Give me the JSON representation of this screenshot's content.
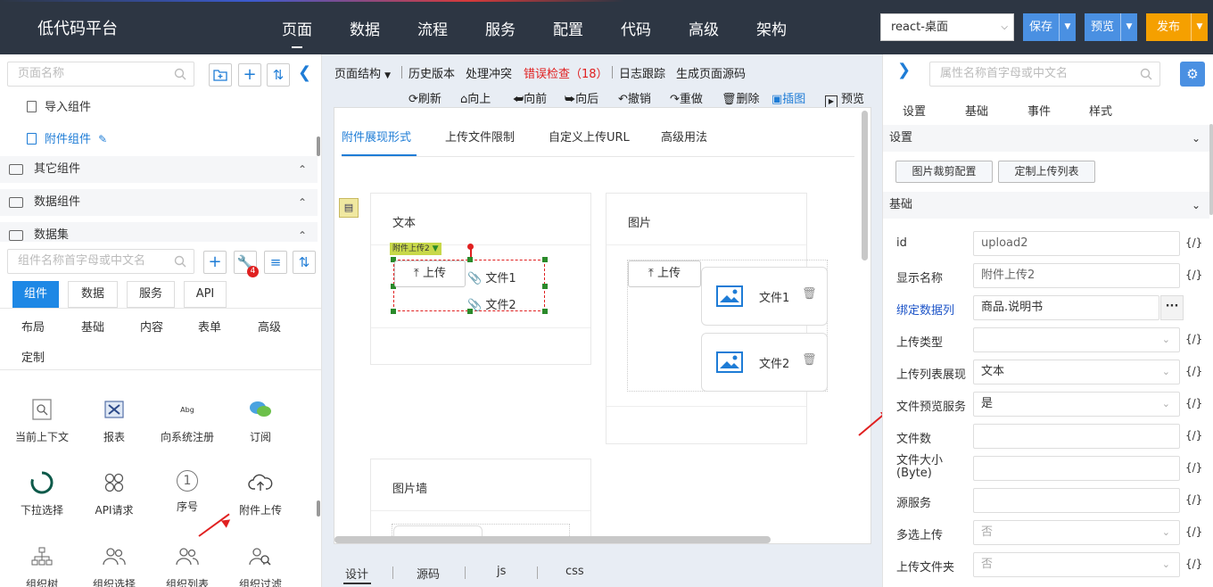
{
  "topbar": {
    "logo": "低代码平台",
    "nav": [
      "页面",
      "数据",
      "流程",
      "服务",
      "配置",
      "代码",
      "高级",
      "架构"
    ],
    "active_nav": "页面",
    "platform_select": "react-桌面",
    "save_label": "保存",
    "preview_label": "预览",
    "publish_label": "发布",
    "colors": {
      "bar": "#2d3643",
      "save": "#4a90e2",
      "publish": "#f5a000"
    }
  },
  "left": {
    "page_search_placeholder": "页面名称",
    "tree": [
      {
        "label": "导入组件"
      },
      {
        "label": "附件组件",
        "selected": true
      }
    ],
    "groups": [
      "其它组件",
      "数据组件",
      "数据集"
    ],
    "comp_search_placeholder": "组件名称首字母或中文名",
    "badge_count": "4",
    "tabs": [
      "组件",
      "数据",
      "服务",
      "API"
    ],
    "active_tab": "组件",
    "categories": [
      "布局",
      "基础",
      "内容",
      "表单",
      "高级",
      "定制"
    ],
    "components": [
      {
        "label": "当前上下文",
        "icon": "context-icon"
      },
      {
        "label": "报表",
        "icon": "report-icon"
      },
      {
        "label": "向系统注册",
        "icon": "abg-icon",
        "icon_text": "Abg"
      },
      {
        "label": "订阅",
        "icon": "chat-icon"
      },
      {
        "label": "下拉选择",
        "icon": "spinner-icon"
      },
      {
        "label": "API请求",
        "icon": "api-icon"
      },
      {
        "label": "序号",
        "icon": "number-icon",
        "icon_text": "1"
      },
      {
        "label": "附件上传",
        "icon": "cloud-upload-icon"
      },
      {
        "label": "组织树",
        "icon": "org-tree-icon"
      },
      {
        "label": "组织选择",
        "icon": "org-select-icon"
      },
      {
        "label": "组织列表",
        "icon": "org-list-icon"
      },
      {
        "label": "组织过滤",
        "icon": "org-filter-icon"
      }
    ]
  },
  "center": {
    "toolbar1": [
      "页面结构",
      "历史版本",
      "处理冲突",
      "错误检查（18）",
      "日志跟踪",
      "生成页面源码"
    ],
    "toolbar2": [
      "刷新",
      "向上",
      "向前",
      "向后",
      "撤销",
      "重做",
      "删除",
      "插图",
      "预览"
    ],
    "canvas_tabs": [
      "附件展现形式",
      "上传文件限制",
      "自定义上传URL",
      "高级用法"
    ],
    "active_canvas_tab": "附件展现形式",
    "card_text": {
      "title": "文本",
      "tag": "附件上传2",
      "upload": "上传",
      "files": [
        "文件1",
        "文件2"
      ]
    },
    "card_image": {
      "title": "图片",
      "upload": "上传",
      "files": [
        "文件1",
        "文件2"
      ]
    },
    "card_wall": {
      "title": "图片墙"
    },
    "bottom_tabs": [
      "设计",
      "源码",
      "js",
      "css"
    ],
    "active_bottom_tab": "设计"
  },
  "right": {
    "search_placeholder": "属性名称首字母或中文名",
    "tabs": [
      "设置",
      "基础",
      "事件",
      "样式"
    ],
    "section_settings": "设置",
    "buttons": [
      "图片裁剪配置",
      "定制上传列表"
    ],
    "section_basic": "基础",
    "fx_label": "{/}",
    "props": [
      {
        "label": "id",
        "value": "upload2",
        "type": "text"
      },
      {
        "label": "显示名称",
        "value": "附件上传2",
        "type": "text"
      },
      {
        "label": "绑定数据列",
        "value": "商品.说明书",
        "type": "bind",
        "link": true
      },
      {
        "label": "上传类型",
        "value": "",
        "type": "select"
      },
      {
        "label": "上传列表展现",
        "value": "文本",
        "type": "select"
      },
      {
        "label": "文件预览服务",
        "value": "是",
        "type": "select"
      },
      {
        "label": "文件数",
        "value": "",
        "type": "text"
      },
      {
        "label": "文件大小(Byte)",
        "value": "",
        "type": "text"
      },
      {
        "label": "源服务",
        "value": "",
        "type": "text"
      },
      {
        "label": "多选上传",
        "value": "否",
        "type": "select",
        "disabled": true
      },
      {
        "label": "上传文件夹",
        "value": "否",
        "type": "select",
        "disabled": true
      }
    ]
  }
}
